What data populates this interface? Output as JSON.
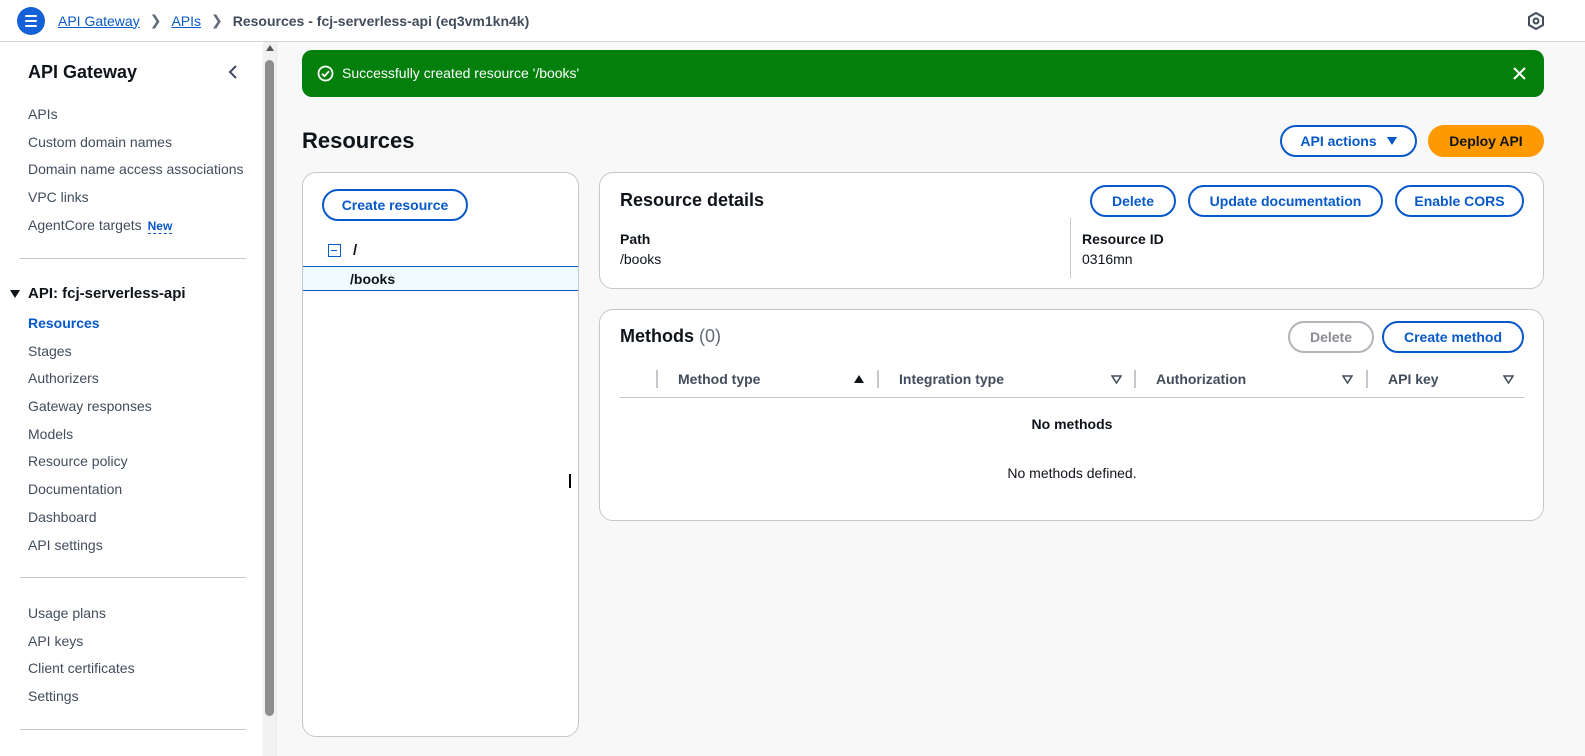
{
  "breadcrumb": {
    "items": [
      "API Gateway",
      "APIs"
    ],
    "current": "Resources - fcj-serverless-api (eq3vm1kn4k)"
  },
  "sidebar": {
    "title": "API Gateway",
    "top_items": [
      "APIs",
      "Custom domain names",
      "Domain name access associations",
      "VPC links",
      "AgentCore targets"
    ],
    "new_badge": "New",
    "api_section": "API: fcj-serverless-api",
    "api_items": [
      "Resources",
      "Stages",
      "Authorizers",
      "Gateway responses",
      "Models",
      "Resource policy",
      "Documentation",
      "Dashboard",
      "API settings"
    ],
    "bottom_items": [
      "Usage plans",
      "API keys",
      "Client certificates",
      "Settings"
    ]
  },
  "flash": {
    "message": "Successfully created resource '/books'"
  },
  "page": {
    "title": "Resources",
    "api_actions_label": "API actions",
    "deploy_label": "Deploy API"
  },
  "tree": {
    "create_resource_label": "Create resource",
    "root": "/",
    "selected": "/books"
  },
  "details": {
    "title": "Resource details",
    "delete_label": "Delete",
    "update_docs_label": "Update documentation",
    "enable_cors_label": "Enable CORS",
    "path_label": "Path",
    "path_value": "/books",
    "id_label": "Resource ID",
    "id_value": "0316mn"
  },
  "methods": {
    "title": "Methods",
    "count": "(0)",
    "delete_label": "Delete",
    "create_label": "Create method",
    "columns": [
      "Method type",
      "Integration type",
      "Authorization",
      "API key"
    ],
    "empty_title": "No methods",
    "empty_message": "No methods defined."
  },
  "colors": {
    "accent": "#0758c9",
    "success": "#037f0c",
    "deploy": "#ff9900"
  }
}
